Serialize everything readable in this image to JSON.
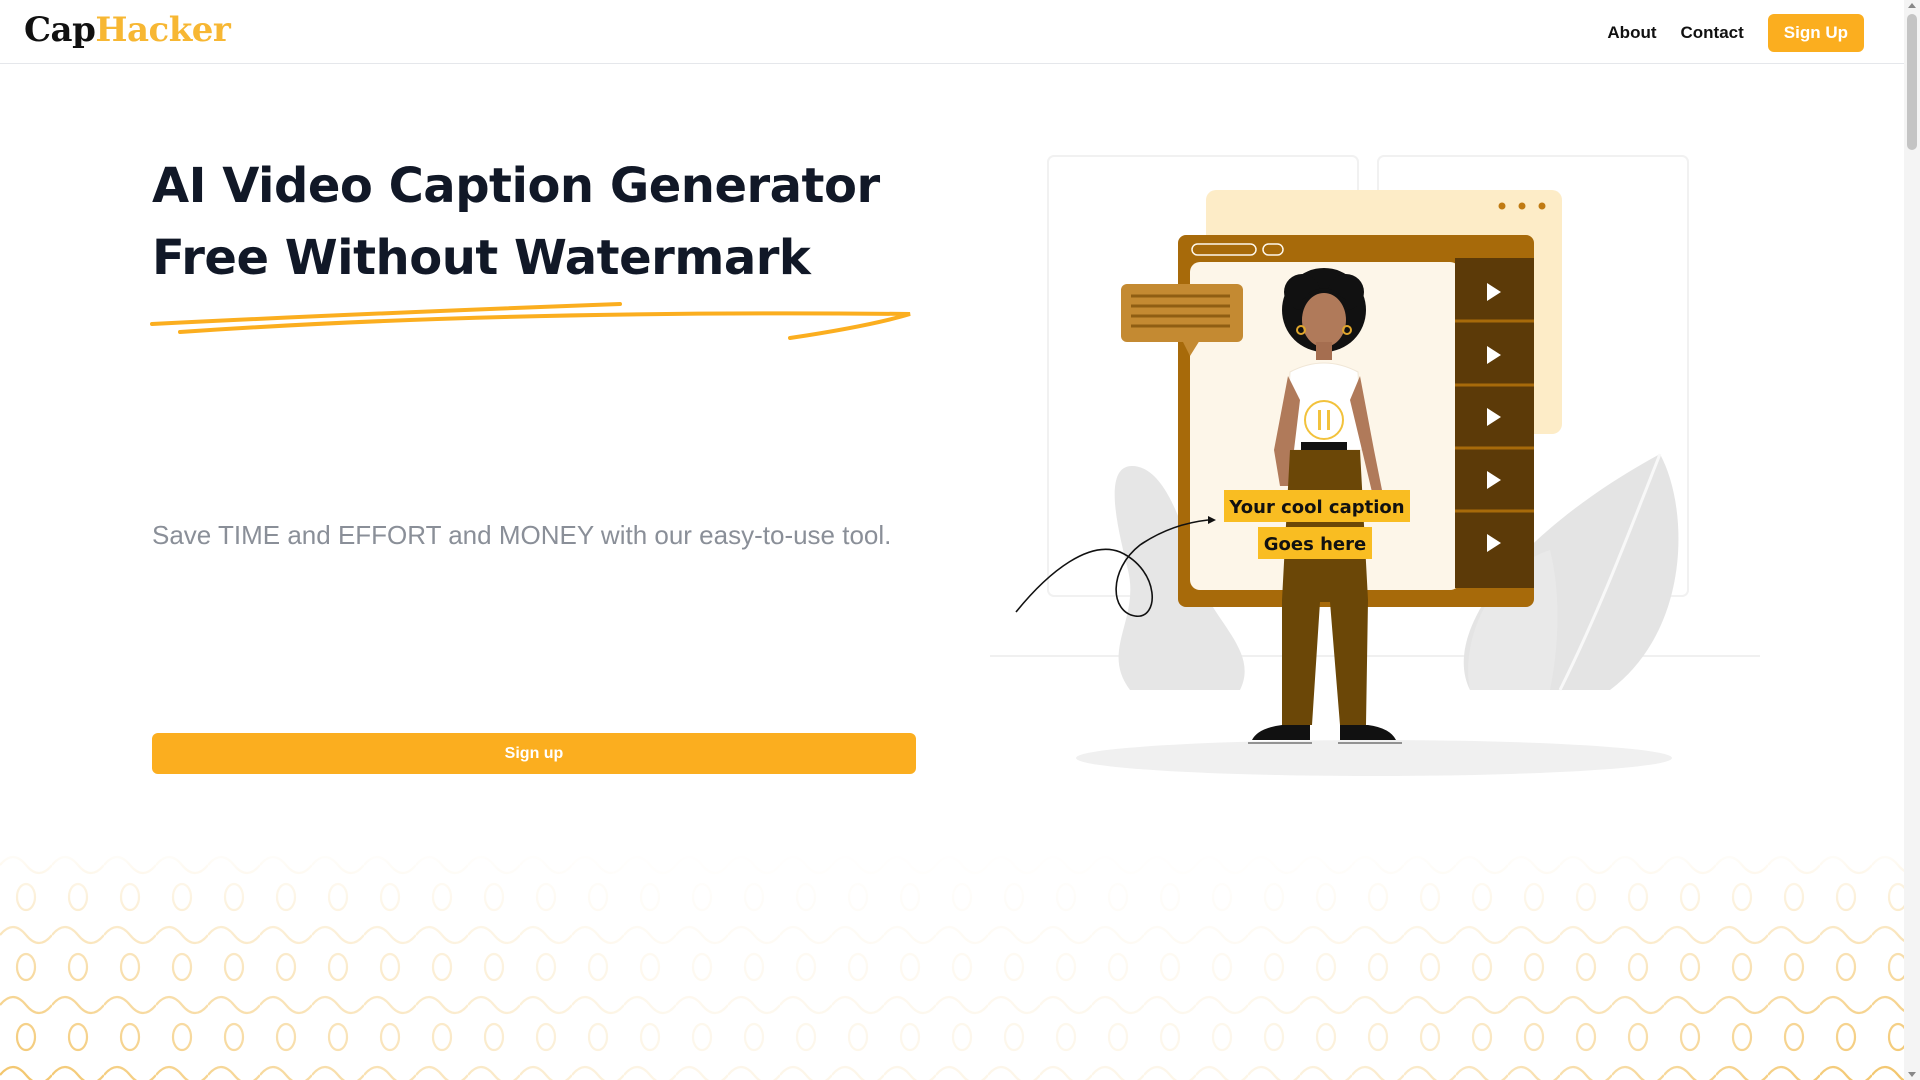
{
  "header": {
    "logo_part1": "Cap",
    "logo_part2": "Hacker",
    "nav": {
      "about": "About",
      "contact": "Contact",
      "signup": "Sign Up"
    }
  },
  "hero": {
    "title_line1": "AI Video Caption Generator",
    "title_line2": "Free Without Watermark",
    "subtitle": "Save TIME and EFFORT and MONEY with our easy-to-use tool.",
    "cta": "Sign up"
  },
  "illustration": {
    "caption_line1": "Your cool caption",
    "caption_line2": "Goes here"
  },
  "colors": {
    "accent": "#fbae1f",
    "logo_accent": "#f7b733",
    "text_dark": "#111827",
    "subtitle_gray": "#8a8f98",
    "brown": "#a76a0a"
  }
}
